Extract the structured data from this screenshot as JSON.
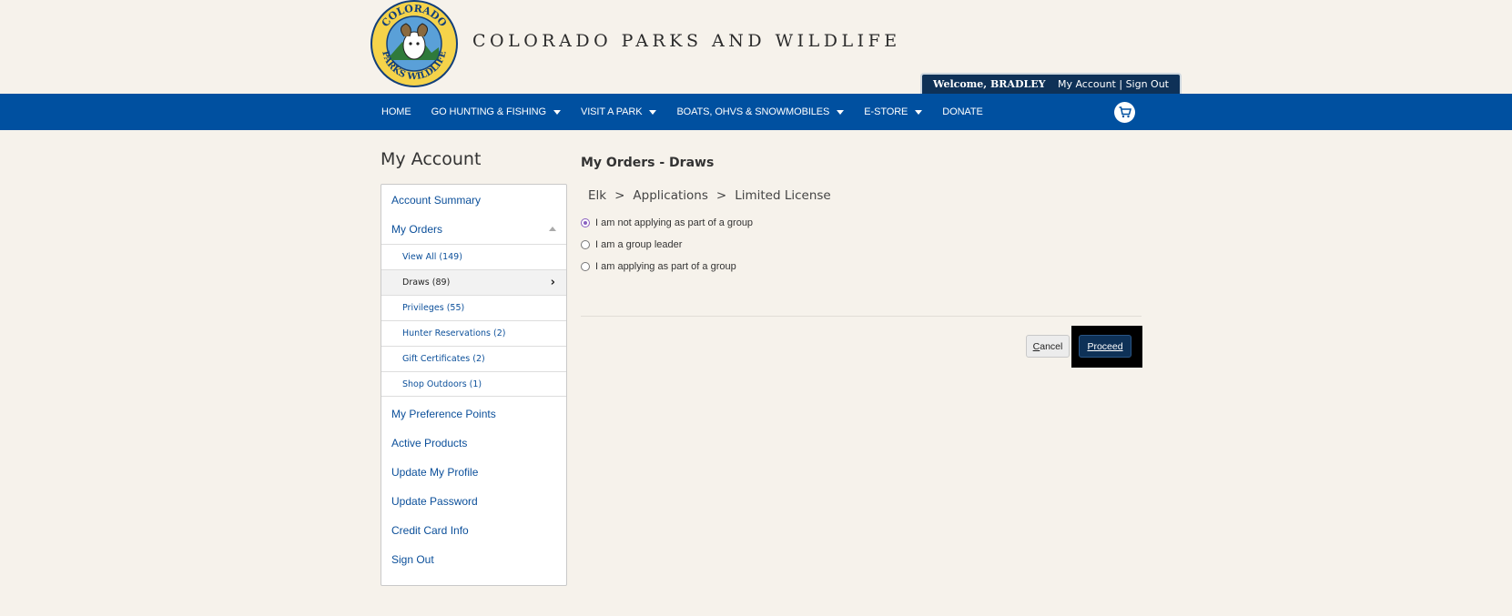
{
  "site": {
    "title": "COLORADO PARKS AND WILDLIFE",
    "logo_icon": "cpw-ram-logo-icon"
  },
  "userbar": {
    "welcome": "Welcome, BRADLEY",
    "links": "My Account | Sign Out"
  },
  "nav": {
    "items": [
      {
        "label": "HOME",
        "dropdown": false
      },
      {
        "label": "GO HUNTING & FISHING",
        "dropdown": true
      },
      {
        "label": "VISIT A PARK",
        "dropdown": true
      },
      {
        "label": "BOATS, OHVS & SNOWMOBILES",
        "dropdown": true
      },
      {
        "label": "E-STORE",
        "dropdown": true
      },
      {
        "label": "DONATE",
        "dropdown": false
      }
    ],
    "cart_icon": "shopping-cart-icon"
  },
  "sidebar": {
    "heading": "My Account",
    "account_summary": "Account Summary",
    "my_orders": "My Orders",
    "sub_items": [
      {
        "label": "View All (149)"
      },
      {
        "label": "Draws (89)"
      },
      {
        "label": "Privileges (55)"
      },
      {
        "label": "Hunter Reservations (2)"
      },
      {
        "label": "Gift Certificates (2)"
      },
      {
        "label": "Shop Outdoors (1)"
      }
    ],
    "links": [
      "My Preference Points",
      "Active Products",
      "Update My Profile",
      "Update Password",
      "Credit Card Info",
      "Sign Out"
    ]
  },
  "main": {
    "title": "My Orders - Draws",
    "breadcrumb": [
      "Elk",
      "Applications",
      "Limited License"
    ],
    "breadcrumb_sep": ">",
    "options": [
      {
        "label": "I am not applying as part of a group",
        "checked": true
      },
      {
        "label": "I am a group leader",
        "checked": false
      },
      {
        "label": "I am applying as part of a group",
        "checked": false
      }
    ],
    "cancel_first": "C",
    "cancel_rest": "ancel",
    "proceed_first": "P",
    "proceed_rest": "roceed"
  },
  "colors": {
    "nav_blue": "#0050a0",
    "dark_navy": "#0e3157",
    "link_blue": "#0b4f9a",
    "background": "#f6f2eb"
  }
}
